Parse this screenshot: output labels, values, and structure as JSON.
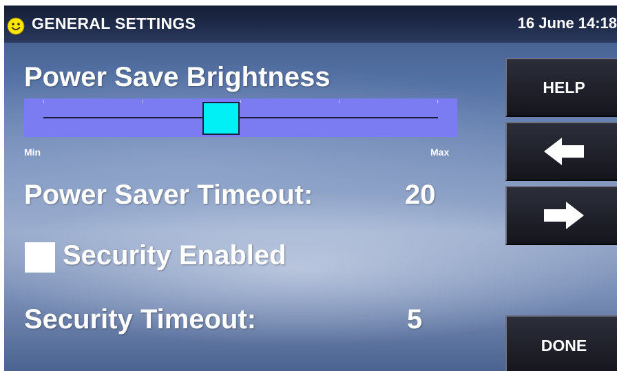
{
  "header": {
    "title": "GENERAL SETTINGS",
    "datetime": "16 June 14:18",
    "status_icon": "smiley-face-icon"
  },
  "brightness": {
    "label": "Power Save Brightness",
    "min_label": "Min",
    "max_label": "Max",
    "level_fraction": 0.45
  },
  "power_saver_timeout": {
    "label": "Power Saver Timeout:",
    "value": "20"
  },
  "security": {
    "label": "Security Enabled",
    "checked": false
  },
  "security_timeout": {
    "label": "Security Timeout:",
    "value": "5"
  },
  "buttons": {
    "help": "HELP",
    "back_icon": "arrow-left-icon",
    "forward_icon": "arrow-right-icon",
    "done": "DONE"
  },
  "colors": {
    "slider_background": "#7b7bf2",
    "slider_thumb": "#00f0f6",
    "smiley": "#ffe600"
  }
}
